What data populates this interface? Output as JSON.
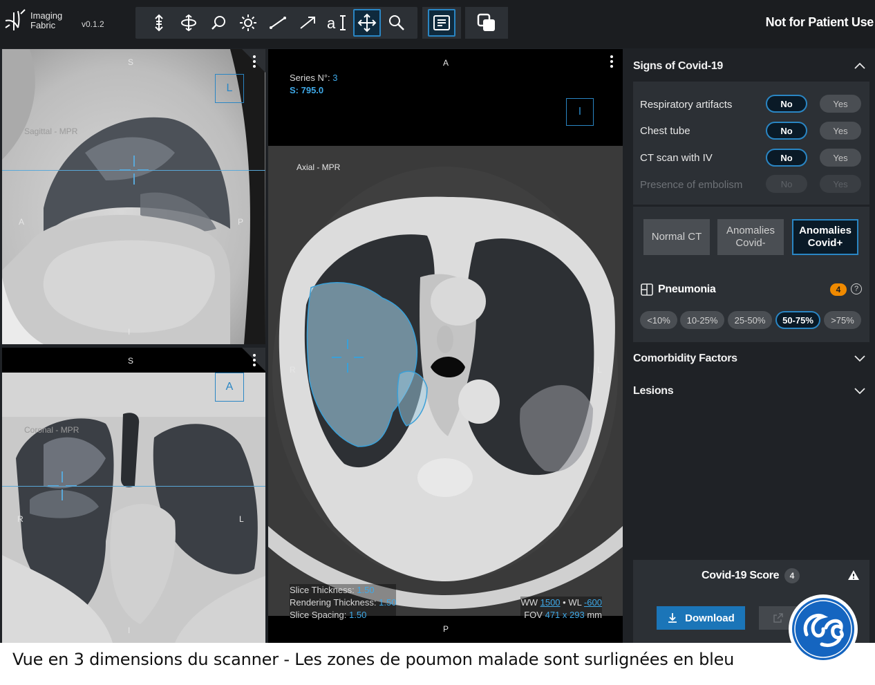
{
  "header": {
    "logo_text": "Imaging Fabric",
    "version": "v0.1.2",
    "disclaimer": "Not for Patient Use",
    "tools": [
      {
        "icon": "scroll-slice-icon"
      },
      {
        "icon": "rotate-3d-icon"
      },
      {
        "icon": "zoom-icon"
      },
      {
        "icon": "window-level-icon"
      },
      {
        "icon": "line-measure-icon"
      },
      {
        "icon": "arrow-annotation-icon"
      },
      {
        "icon": "text-annotation-icon"
      },
      {
        "icon": "pan-icon",
        "active": true
      },
      {
        "icon": "magnifier-icon"
      }
    ],
    "report_tool_icon": "report-icon",
    "layers_tool_icon": "layers-icon"
  },
  "viewports": {
    "sagittal": {
      "label": "Sagittal - MPR",
      "orientation": "L",
      "top": "S",
      "bottom": "I",
      "left": "A",
      "right": "P"
    },
    "coronal": {
      "label": "Coronal - MPR",
      "orientation": "A",
      "top": "S",
      "bottom": "I",
      "left": "R",
      "right": "L"
    },
    "axial": {
      "label": "Axial - MPR",
      "orientation": "I",
      "top": "A",
      "bottom": "P",
      "left": "R",
      "right": "L",
      "series_label": "Series N°:",
      "series_value": "3",
      "s_value": "S: 795.0",
      "slice_thickness_label": "Slice Thickness:",
      "slice_thickness": "1.50",
      "rendering_thickness_label": "Rendering Thickness:",
      "rendering_thickness": "1.50",
      "slice_spacing_label": "Slice Spacing:",
      "slice_spacing": "1.50",
      "ww_label": "WW",
      "ww": "1500",
      "wl_label": "WL",
      "wl": "-600",
      "fov_label": "FOV",
      "fov": "471 x 293",
      "fov_unit": "mm"
    }
  },
  "panel": {
    "signs_title": "Signs of Covid-19",
    "rows": [
      {
        "label": "Respiratory artifacts",
        "no": "No",
        "yes": "Yes",
        "selected": "no",
        "enabled": true
      },
      {
        "label": "Chest tube",
        "no": "No",
        "yes": "Yes",
        "selected": "no",
        "enabled": true
      },
      {
        "label": "CT scan with IV",
        "no": "No",
        "yes": "Yes",
        "selected": "no",
        "enabled": true
      },
      {
        "label": "Presence of embolism",
        "no": "No",
        "yes": "Yes",
        "selected": "none",
        "enabled": false
      }
    ],
    "ct_buttons": [
      {
        "label": "Normal CT",
        "selected": false
      },
      {
        "label": "Anomalies Covid-",
        "selected": false
      },
      {
        "label": "Anomalies Covid+",
        "selected": true
      }
    ],
    "pneumonia_title": "Pneumonia",
    "pneumonia_badge": "4",
    "pneumonia_help": "?",
    "pneumonia_ranges": [
      {
        "label": "<10%",
        "selected": false
      },
      {
        "label": "10-25%",
        "selected": false
      },
      {
        "label": "25-50%",
        "selected": false
      },
      {
        "label": "50-75%",
        "selected": true
      },
      {
        "label": ">75%",
        "selected": false
      }
    ],
    "comorbidity_title": "Comorbidity Factors",
    "lesions_title": "Lesions",
    "score_label": "Covid-19 Score",
    "score_value": "4",
    "download_label": "Download"
  },
  "colors": {
    "accent": "#2a86c4",
    "panel_bg": "#1f2226",
    "card_bg": "#2c3035",
    "badge_orange": "#f08a00",
    "download_blue": "#1b75b8"
  },
  "caption": "Vue en 3 dimensions du scanner - Les zones de poumon malade sont surlignées en bleu"
}
